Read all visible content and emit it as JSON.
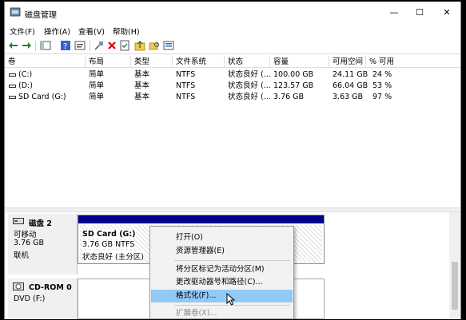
{
  "window": {
    "title": "磁盘管理",
    "minimize": "—",
    "maximize": "☐",
    "close": "✕"
  },
  "menu": [
    "文件(F)",
    "操作(A)",
    "查看(V)",
    "帮助(H)"
  ],
  "columns": [
    "卷",
    "布局",
    "类型",
    "文件系统",
    "状态",
    "容量",
    "可用空间",
    "% 可用"
  ],
  "volumes": [
    {
      "name": "(C:)",
      "layout": "简单",
      "type": "基本",
      "fs": "NTFS",
      "status": "状态良好 (...",
      "capacity": "100.00 GB",
      "free": "24.11 GB",
      "pct": "24 %"
    },
    {
      "name": "(D:)",
      "layout": "简单",
      "type": "基本",
      "fs": "NTFS",
      "status": "状态良好 (...",
      "capacity": "123.57 GB",
      "free": "66.04 GB",
      "pct": "53 %"
    },
    {
      "name": "SD Card (G:)",
      "layout": "简单",
      "type": "基本",
      "fs": "NTFS",
      "status": "状态良好 (...",
      "capacity": "3.76 GB",
      "free": "3.63 GB",
      "pct": "97 %"
    }
  ],
  "disks": [
    {
      "name": "磁盘 2",
      "kind": "可移动",
      "size": "3.76 GB",
      "state": "联机",
      "partition": {
        "name": "SD Card (G:)",
        "size_fs": "3.76 GB NTFS",
        "status": "状态良好 (主分区)"
      }
    },
    {
      "name": "CD-ROM 0",
      "kind": "DVD (F:)"
    }
  ],
  "context_menu": {
    "items": [
      "打开(O)",
      "资源管理器(E)",
      "将分区标记为活动分区(M)",
      "更改驱动器号和路径(C)...",
      "格式化(F)...",
      "扩展卷(X)..."
    ],
    "highlighted_index": 4,
    "disabled_index": 5
  },
  "colors": {
    "partition_bar": "#00008b",
    "highlight": "#91c9f7"
  }
}
